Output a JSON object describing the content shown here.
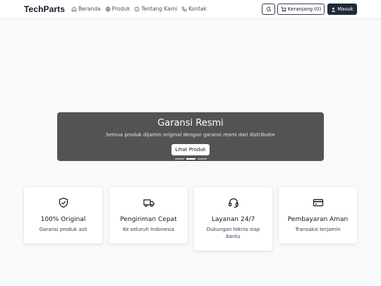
{
  "nav": {
    "brand": "TechParts",
    "links": [
      {
        "label": "Beranda",
        "icon": "home-icon"
      },
      {
        "label": "Produk",
        "icon": "globe-icon"
      },
      {
        "label": "Tentang Kami",
        "icon": "info-icon"
      },
      {
        "label": "Kontak",
        "icon": "phone-icon"
      }
    ],
    "theme_icon": "moon-icon",
    "cart_label": "Keranjang (0)",
    "login_label": "Masuk"
  },
  "carousel": {
    "title": "Garansi Resmi",
    "description": "Semua produk dijamin original dengan garansi resmi dari distributor",
    "button_label": "Lihat Produk",
    "active_index": 1,
    "slide_count": 3
  },
  "features": [
    {
      "icon": "shield-check-icon",
      "title": "100% Original",
      "desc": "Garansi produk asli"
    },
    {
      "icon": "truck-icon",
      "title": "Pengiriman Cepat",
      "desc": "Ke seluruh Indonesia"
    },
    {
      "icon": "headset-icon",
      "title": "Layanan 24/7",
      "desc": "Dukungan teknis siap bantu"
    },
    {
      "icon": "credit-card-icon",
      "title": "Pembayaran Aman",
      "desc": "Transaksi terjamin"
    }
  ],
  "colors": {
    "slide_bg": "#535353",
    "primary_dark": "#1f2937",
    "page_bg": "#f8f9fb"
  }
}
